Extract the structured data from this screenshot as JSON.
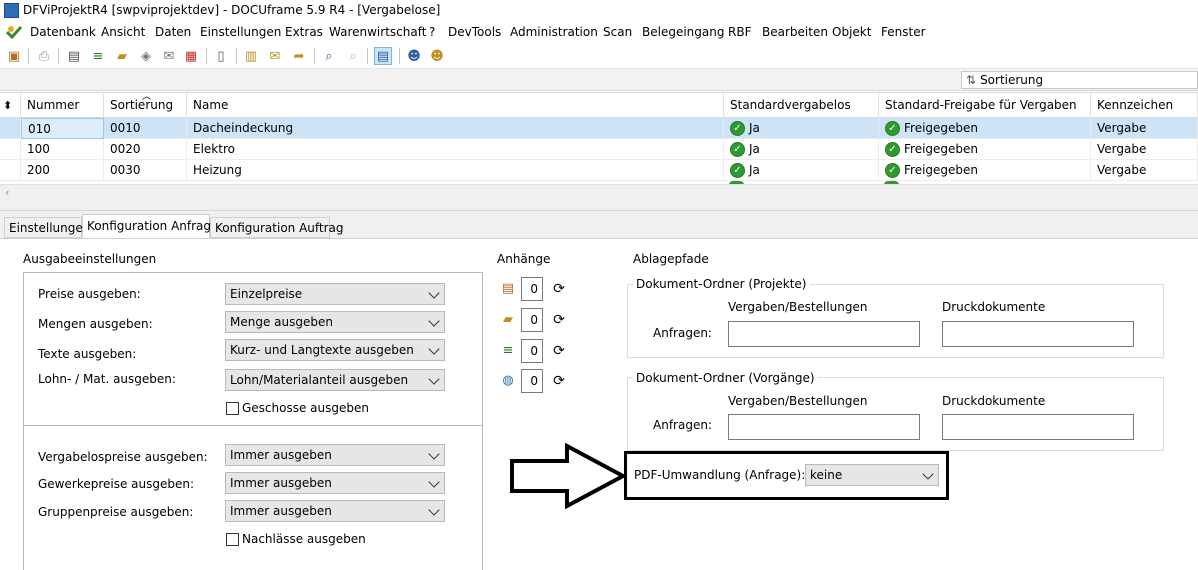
{
  "window": {
    "title": "DFViProjektR4 [swpviprojektdev] - DOCUframe 5.9 R4 - [Vergabelose]"
  },
  "menu": [
    "Datenbank",
    "Ansicht",
    "Daten",
    "Einstellungen",
    "Extras",
    "Warenwirtschaft",
    "?",
    "DevTools",
    "Administration",
    "Scan",
    "Belegeingang",
    "RBF",
    "Bearbeiten",
    "Objekt",
    "Fenster"
  ],
  "toolbar": {
    "sort_label": "Sortierung"
  },
  "grid": {
    "columns": [
      "Nummer",
      "Sortierung",
      "Name",
      "Standardvergabelos",
      "Standard-Freigabe für Vergaben",
      "Kennzeichen"
    ],
    "rows": [
      {
        "nummer": "010",
        "sortierung": "0010",
        "name": "Dacheindeckung",
        "std": "Ja",
        "freigabe": "Freigegeben",
        "kennzeichen": "Vergabe"
      },
      {
        "nummer": "100",
        "sortierung": "0020",
        "name": "Elektro",
        "std": "Ja",
        "freigabe": "Freigegeben",
        "kennzeichen": "Vergabe"
      },
      {
        "nummer": "200",
        "sortierung": "0030",
        "name": "Heizung",
        "std": "Ja",
        "freigabe": "Freigegeben",
        "kennzeichen": "Vergabe"
      }
    ]
  },
  "tabs": [
    "Einstellungen",
    "Konfiguration Anfrage",
    "Konfiguration Auftrag"
  ],
  "ausgabe": {
    "title": "Ausgabeeinstellungen",
    "preise_label": "Preise ausgeben:",
    "preise_value": "Einzelpreise",
    "mengen_label": "Mengen ausgeben:",
    "mengen_value": "Menge ausgeben",
    "texte_label": "Texte ausgeben:",
    "texte_value": "Kurz- und Langtexte ausgeben",
    "lohn_label": "Lohn- / Mat. ausgeben:",
    "lohn_value": "Lohn/Materialanteil ausgeben",
    "geschosse_label": "Geschosse ausgeben",
    "vergabelos_label": "Vergabelospreise ausgeben:",
    "vergabelos_value": "Immer ausgeben",
    "gewerk_label": "Gewerkepreise ausgeben:",
    "gewerk_value": "Immer ausgeben",
    "gruppen_label": "Gruppenpreise ausgeben:",
    "gruppen_value": "Immer ausgeben",
    "nachlaesse_label": "Nachlässe ausgeben"
  },
  "anhaenge": {
    "title": "Anhänge",
    "counts": [
      "0",
      "0",
      "0",
      "0"
    ]
  },
  "ablage": {
    "title": "Ablagepfade",
    "projekte_title": "Dokument-Ordner (Projekte)",
    "vorgaenge_title": "Dokument-Ordner (Vorgänge)",
    "col1": "Vergaben/Bestellungen",
    "col2": "Druckdokumente",
    "anfragen_label": "Anfragen:",
    "pdf_label": "PDF-Umwandlung (Anfrage):",
    "pdf_value": "keine"
  }
}
